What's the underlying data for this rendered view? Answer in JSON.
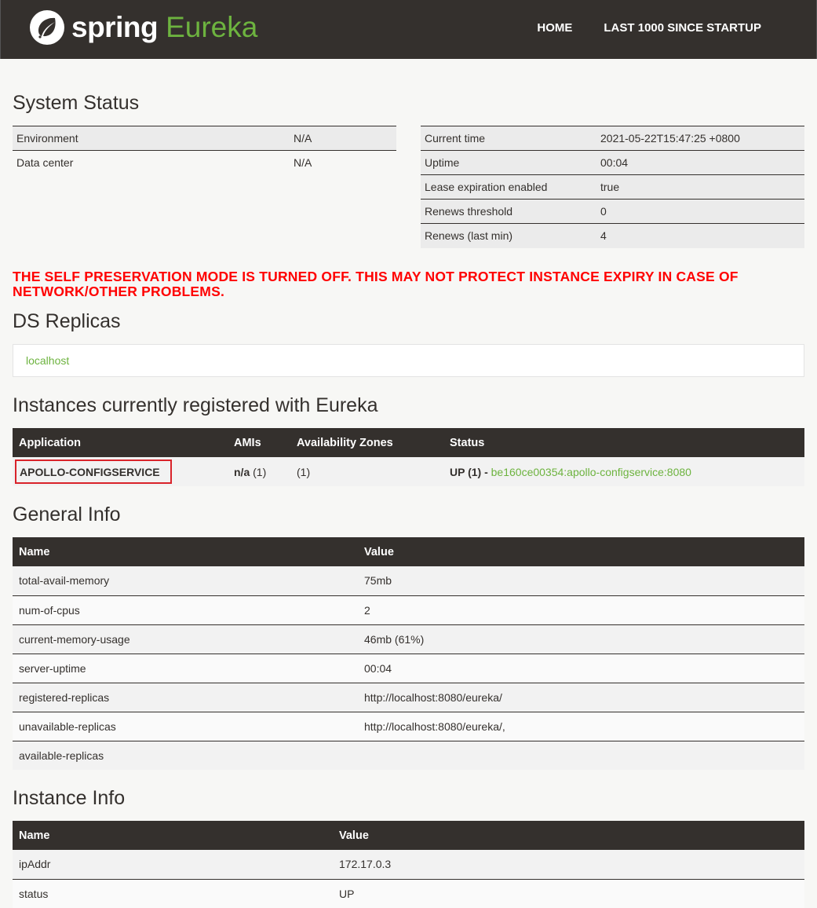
{
  "nav": {
    "brand_spring": "spring",
    "brand_eureka": "Eureka",
    "home": "HOME",
    "last1000": "LAST 1000 SINCE STARTUP"
  },
  "system_status": {
    "title": "System Status",
    "left": [
      {
        "label": "Environment",
        "value": "N/A"
      },
      {
        "label": "Data center",
        "value": "N/A"
      }
    ],
    "right": [
      {
        "label": "Current time",
        "value": "2021-05-22T15:47:25 +0800"
      },
      {
        "label": "Uptime",
        "value": "00:04"
      },
      {
        "label": "Lease expiration enabled",
        "value": "true"
      },
      {
        "label": "Renews threshold",
        "value": "0"
      },
      {
        "label": "Renews (last min)",
        "value": "4"
      }
    ]
  },
  "warning": "THE SELF PRESERVATION MODE IS TURNED OFF. THIS MAY NOT PROTECT INSTANCE EXPIRY IN CASE OF NETWORK/OTHER PROBLEMS.",
  "ds_replicas": {
    "title": "DS Replicas",
    "link": "localhost"
  },
  "instances": {
    "title": "Instances currently registered with Eureka",
    "headers": [
      "Application",
      "AMIs",
      "Availability Zones",
      "Status"
    ],
    "row": {
      "application": "APOLLO-CONFIGSERVICE",
      "amis_bold": "n/a",
      "amis_count": "(1)",
      "zones": "(1)",
      "status_prefix": "UP (1) - ",
      "status_link": "be160ce00354:apollo-configservice:8080"
    }
  },
  "general_info": {
    "title": "General Info",
    "headers": [
      "Name",
      "Value"
    ],
    "rows": [
      {
        "name": "total-avail-memory",
        "value": "75mb"
      },
      {
        "name": "num-of-cpus",
        "value": "2"
      },
      {
        "name": "current-memory-usage",
        "value": "46mb (61%)"
      },
      {
        "name": "server-uptime",
        "value": "00:04"
      },
      {
        "name": "registered-replicas",
        "value": "http://localhost:8080/eureka/"
      },
      {
        "name": "unavailable-replicas",
        "value": "http://localhost:8080/eureka/,"
      },
      {
        "name": "available-replicas",
        "value": ""
      }
    ]
  },
  "instance_info": {
    "title": "Instance Info",
    "headers": [
      "Name",
      "Value"
    ],
    "rows": [
      {
        "name": "ipAddr",
        "value": "172.17.0.3"
      },
      {
        "name": "status",
        "value": "UP"
      }
    ]
  }
}
